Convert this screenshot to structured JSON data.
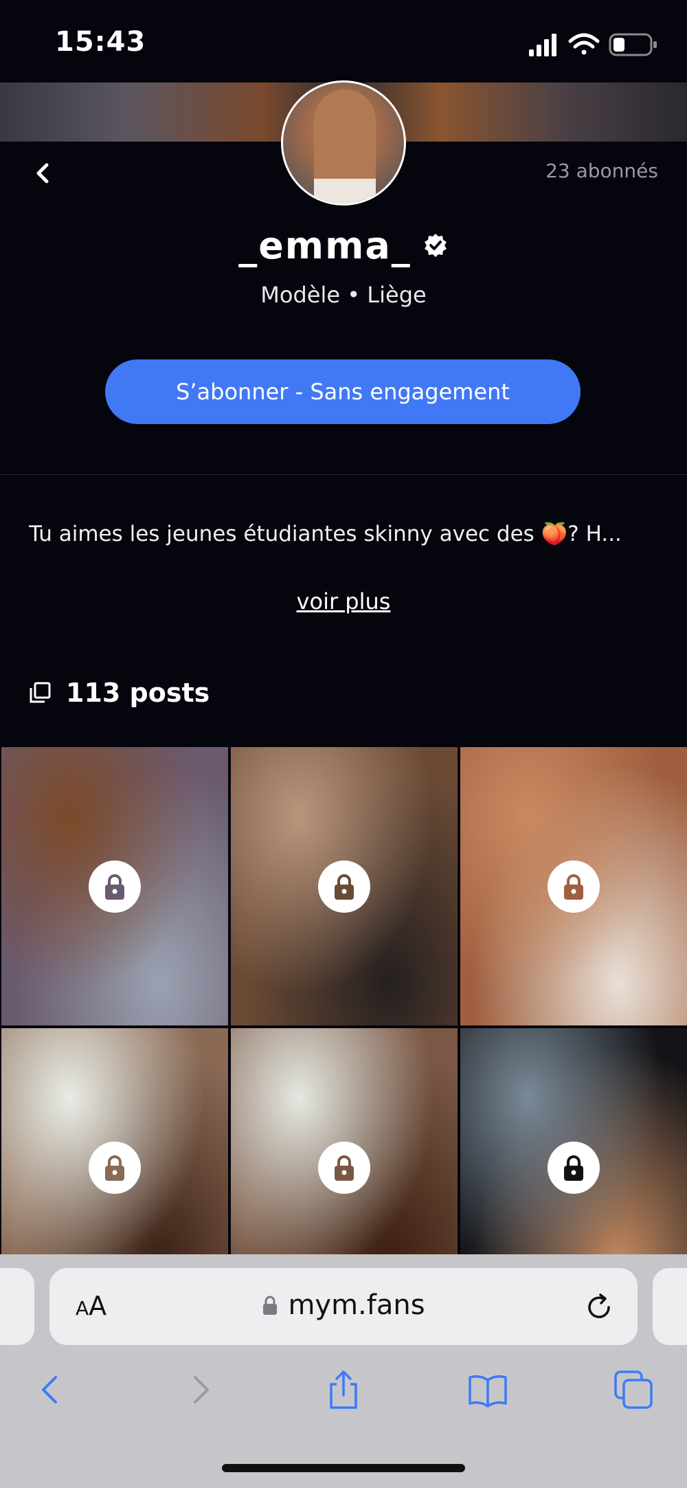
{
  "status": {
    "time": "15:43"
  },
  "profile": {
    "subscribers": "23 abonnés",
    "username": "_emma_",
    "subtitle": "Modèle • Liège",
    "subscribe_label": "S’abonner - Sans engagement",
    "bio": "Tu aimes les jeunes étudiantes skinny avec des 🍑? H...",
    "see_more": "voir plus",
    "posts_count": "113 posts"
  },
  "grid": {
    "tiles": [
      {
        "locked": true,
        "colors": [
          "#7d4a2a",
          "#6a5a70",
          "#9aa2b0"
        ]
      },
      {
        "locked": true,
        "colors": [
          "#b8967e",
          "#6a4a35",
          "#252020"
        ]
      },
      {
        "locked": true,
        "colors": [
          "#c98a62",
          "#a06040",
          "#e8e0d6"
        ]
      },
      {
        "locked": true,
        "colors": [
          "#e8ece6",
          "#8a6a55",
          "#3a2015"
        ]
      },
      {
        "locked": true,
        "colors": [
          "#e4e8e2",
          "#7a5845",
          "#3a1e10"
        ]
      },
      {
        "locked": true,
        "colors": [
          "#7a8a98",
          "#141418",
          "#c48a60"
        ]
      }
    ]
  },
  "browser": {
    "aa_small": "A",
    "aa_large": "A",
    "url": "mym.fans",
    "accent": "#3d7af5"
  },
  "colors": {
    "background": "#05050d",
    "primary_button": "#4178f5",
    "muted_text": "#9a9aa3"
  }
}
